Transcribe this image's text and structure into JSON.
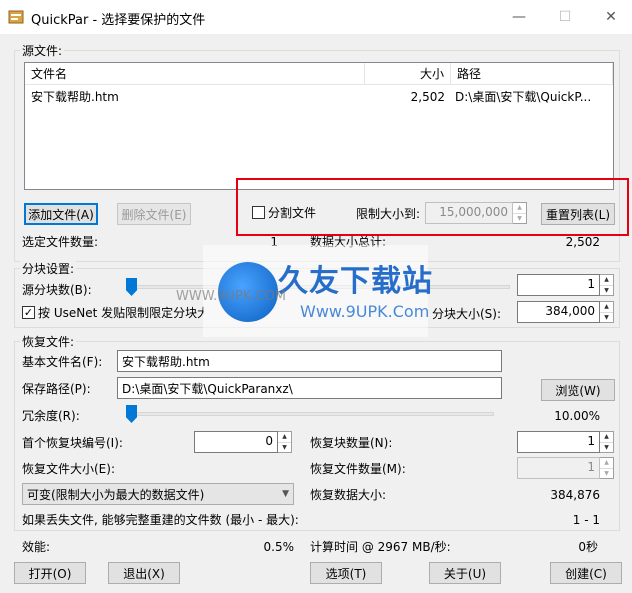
{
  "window": {
    "title": "QuickPar - 选择要保护的文件",
    "minimize": "—",
    "maximize": "☐",
    "close": "✕"
  },
  "source": {
    "group_label": "源文件:",
    "columns": [
      "文件名",
      "大小",
      "路径"
    ],
    "files": [
      {
        "name": "安下载帮助.htm",
        "size": "2,502",
        "path": "D:\\桌面\\安下载\\QuickP..."
      }
    ],
    "add_button": "添加文件(A)",
    "remove_button": "删除文件(E)",
    "split_label": "分割文件",
    "split_checked": false,
    "limit_label": "限制大小到:",
    "limit_value": "15,000,000",
    "reset_button": "重置列表(L)",
    "selected_count_label": "选定文件数量:",
    "selected_count": "1",
    "total_size_label": "数据大小总计:",
    "total_size": "2,502"
  },
  "blocks": {
    "group_label": "分块设置:",
    "source_blocks_label": "源分块数(B):",
    "source_blocks": "1",
    "usenet_label": "按 UseNet 发贴限制限定分块大小",
    "usenet_checked": true,
    "block_size_label": "分块大小(S):",
    "block_size": "384,000"
  },
  "recovery": {
    "group_label": "恢复文件:",
    "base_name_label": "基本文件名(F):",
    "base_name": "安下载帮助.htm",
    "save_path_label": "保存路径(P):",
    "save_path": "D:\\桌面\\安下载\\QuickParanxz\\",
    "browse_button": "浏览(W)",
    "redundancy_label": "冗余度(R):",
    "redundancy": "10.00%",
    "first_block_label": "首个恢复块编号(I):",
    "first_block": "0",
    "block_count_label": "恢复块数量(N):",
    "block_count": "1",
    "file_size_label": "恢复文件大小(E):",
    "file_count_label": "恢复文件数量(M):",
    "file_count": "1",
    "size_mode": "可变(限制大小为最大的数据文件)",
    "data_size_label": "恢复数据大小:",
    "data_size": "384,876",
    "rebuild_label": "如果丢失文件, 能够完整重建的文件数 (最小 - 最大):",
    "rebuild_value": "1 - 1"
  },
  "footer": {
    "efficiency_label": "效能:",
    "efficiency": "0.5%",
    "calc_time_label": "计算时间 @ 2967 MB/秒:",
    "calc_time": "0秒",
    "open_button": "打开(O)",
    "exit_button": "退出(X)",
    "options_button": "选项(T)",
    "about_button": "关于(U)",
    "create_button": "创建(C)"
  },
  "watermark": {
    "brand": "久友下载站",
    "url": "Www.9UPK.Com",
    "gray_url": "WWW.9UPK.COM"
  },
  "colors": {
    "accent": "#0078d7",
    "highlight_box": "#e60012"
  }
}
